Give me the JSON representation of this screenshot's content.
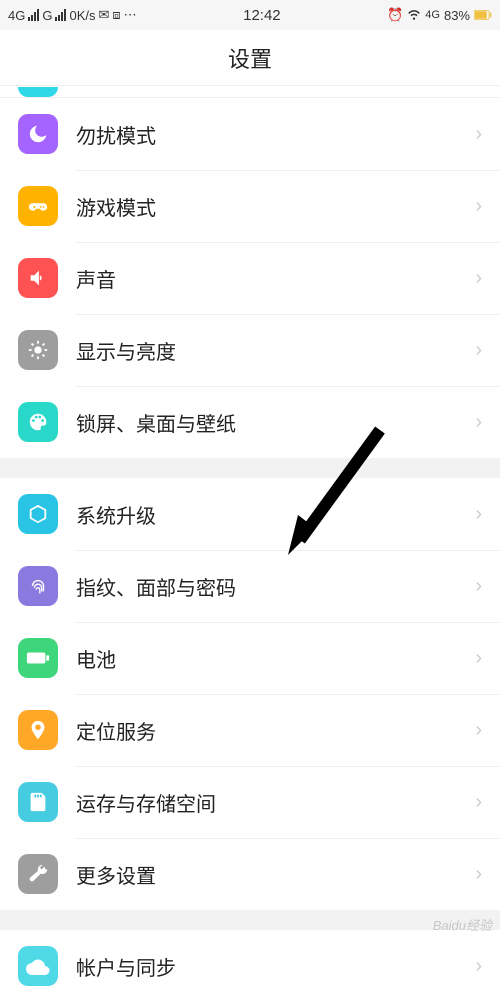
{
  "status": {
    "net1": "4G",
    "net2": "G",
    "speed": "0K/s",
    "time": "12:42",
    "signal2": "4G",
    "battery": "83%"
  },
  "header": {
    "title": "设置"
  },
  "groups": [
    {
      "rows": [
        {
          "id": "dnd",
          "label": "勿扰模式",
          "icon": "dnd"
        },
        {
          "id": "game",
          "label": "游戏模式",
          "icon": "game"
        },
        {
          "id": "sound",
          "label": "声音",
          "icon": "sound"
        },
        {
          "id": "display",
          "label": "显示与亮度",
          "icon": "display"
        },
        {
          "id": "lock",
          "label": "锁屏、桌面与壁纸",
          "icon": "lock"
        }
      ]
    },
    {
      "rows": [
        {
          "id": "system",
          "label": "系统升级",
          "icon": "system"
        },
        {
          "id": "finger",
          "label": "指纹、面部与密码",
          "icon": "finger"
        },
        {
          "id": "battery",
          "label": "电池",
          "icon": "battery"
        },
        {
          "id": "location",
          "label": "定位服务",
          "icon": "location"
        },
        {
          "id": "storage",
          "label": "运存与存储空间",
          "icon": "storage"
        },
        {
          "id": "more",
          "label": "更多设置",
          "icon": "more"
        }
      ]
    },
    {
      "rows": [
        {
          "id": "account",
          "label": "帐户与同步",
          "icon": "account"
        }
      ]
    }
  ],
  "watermark": "Baidu经验"
}
